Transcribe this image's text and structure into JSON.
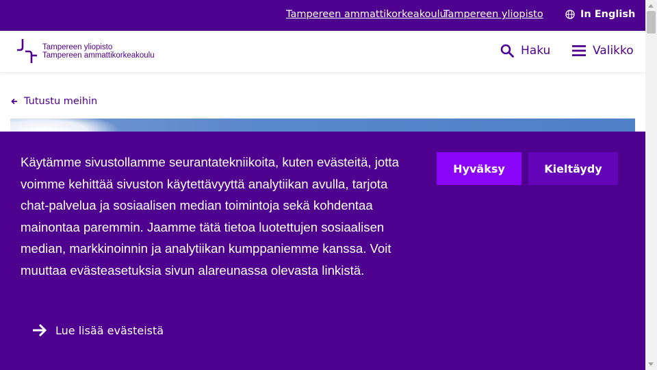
{
  "topbar": {
    "link_tamk": "Tampereen ammattikorkeakoulu",
    "link_tuni": "Tampereen yliopisto",
    "language": "In English"
  },
  "header": {
    "logo_line1": "Tampereen yliopisto",
    "logo_line2": "Tampereen ammattikorkeakoulu",
    "search_label": "Haku",
    "menu_label": "Valikko"
  },
  "breadcrumb": {
    "back_label": "Tutustu meihin"
  },
  "cookie_banner": {
    "text": "Käytämme sivustollamme seurantatekniikoita, kuten evästeitä, jotta voimme kehittää sivuston käytettävyyttä analytiikan avulla, tarjota chat-palvelua ja sosiaalisen median toimintoja sekä kohdentaa mainontaa paremmin. Jaamme tätä tietoa luotettujen sosiaalisen median, markkinoinnin ja analytiikan kumppaniemme kanssa. Voit muuttaa evästeasetuksia sivun alareunassa olevasta linkistä.",
    "accept_label": "Hyväksy",
    "decline_label": "Kieltäydy",
    "read_more_label": "Lue lisää evästeistä"
  },
  "colors": {
    "brand_purple": "#4e008e",
    "accept_button": "#8a05f7",
    "decline_button": "#6404b8"
  },
  "icons": {
    "globe": "globe-icon",
    "search": "search-icon",
    "menu": "hamburger-icon",
    "back": "arrow-left-icon",
    "read_more": "arrow-right-icon"
  }
}
